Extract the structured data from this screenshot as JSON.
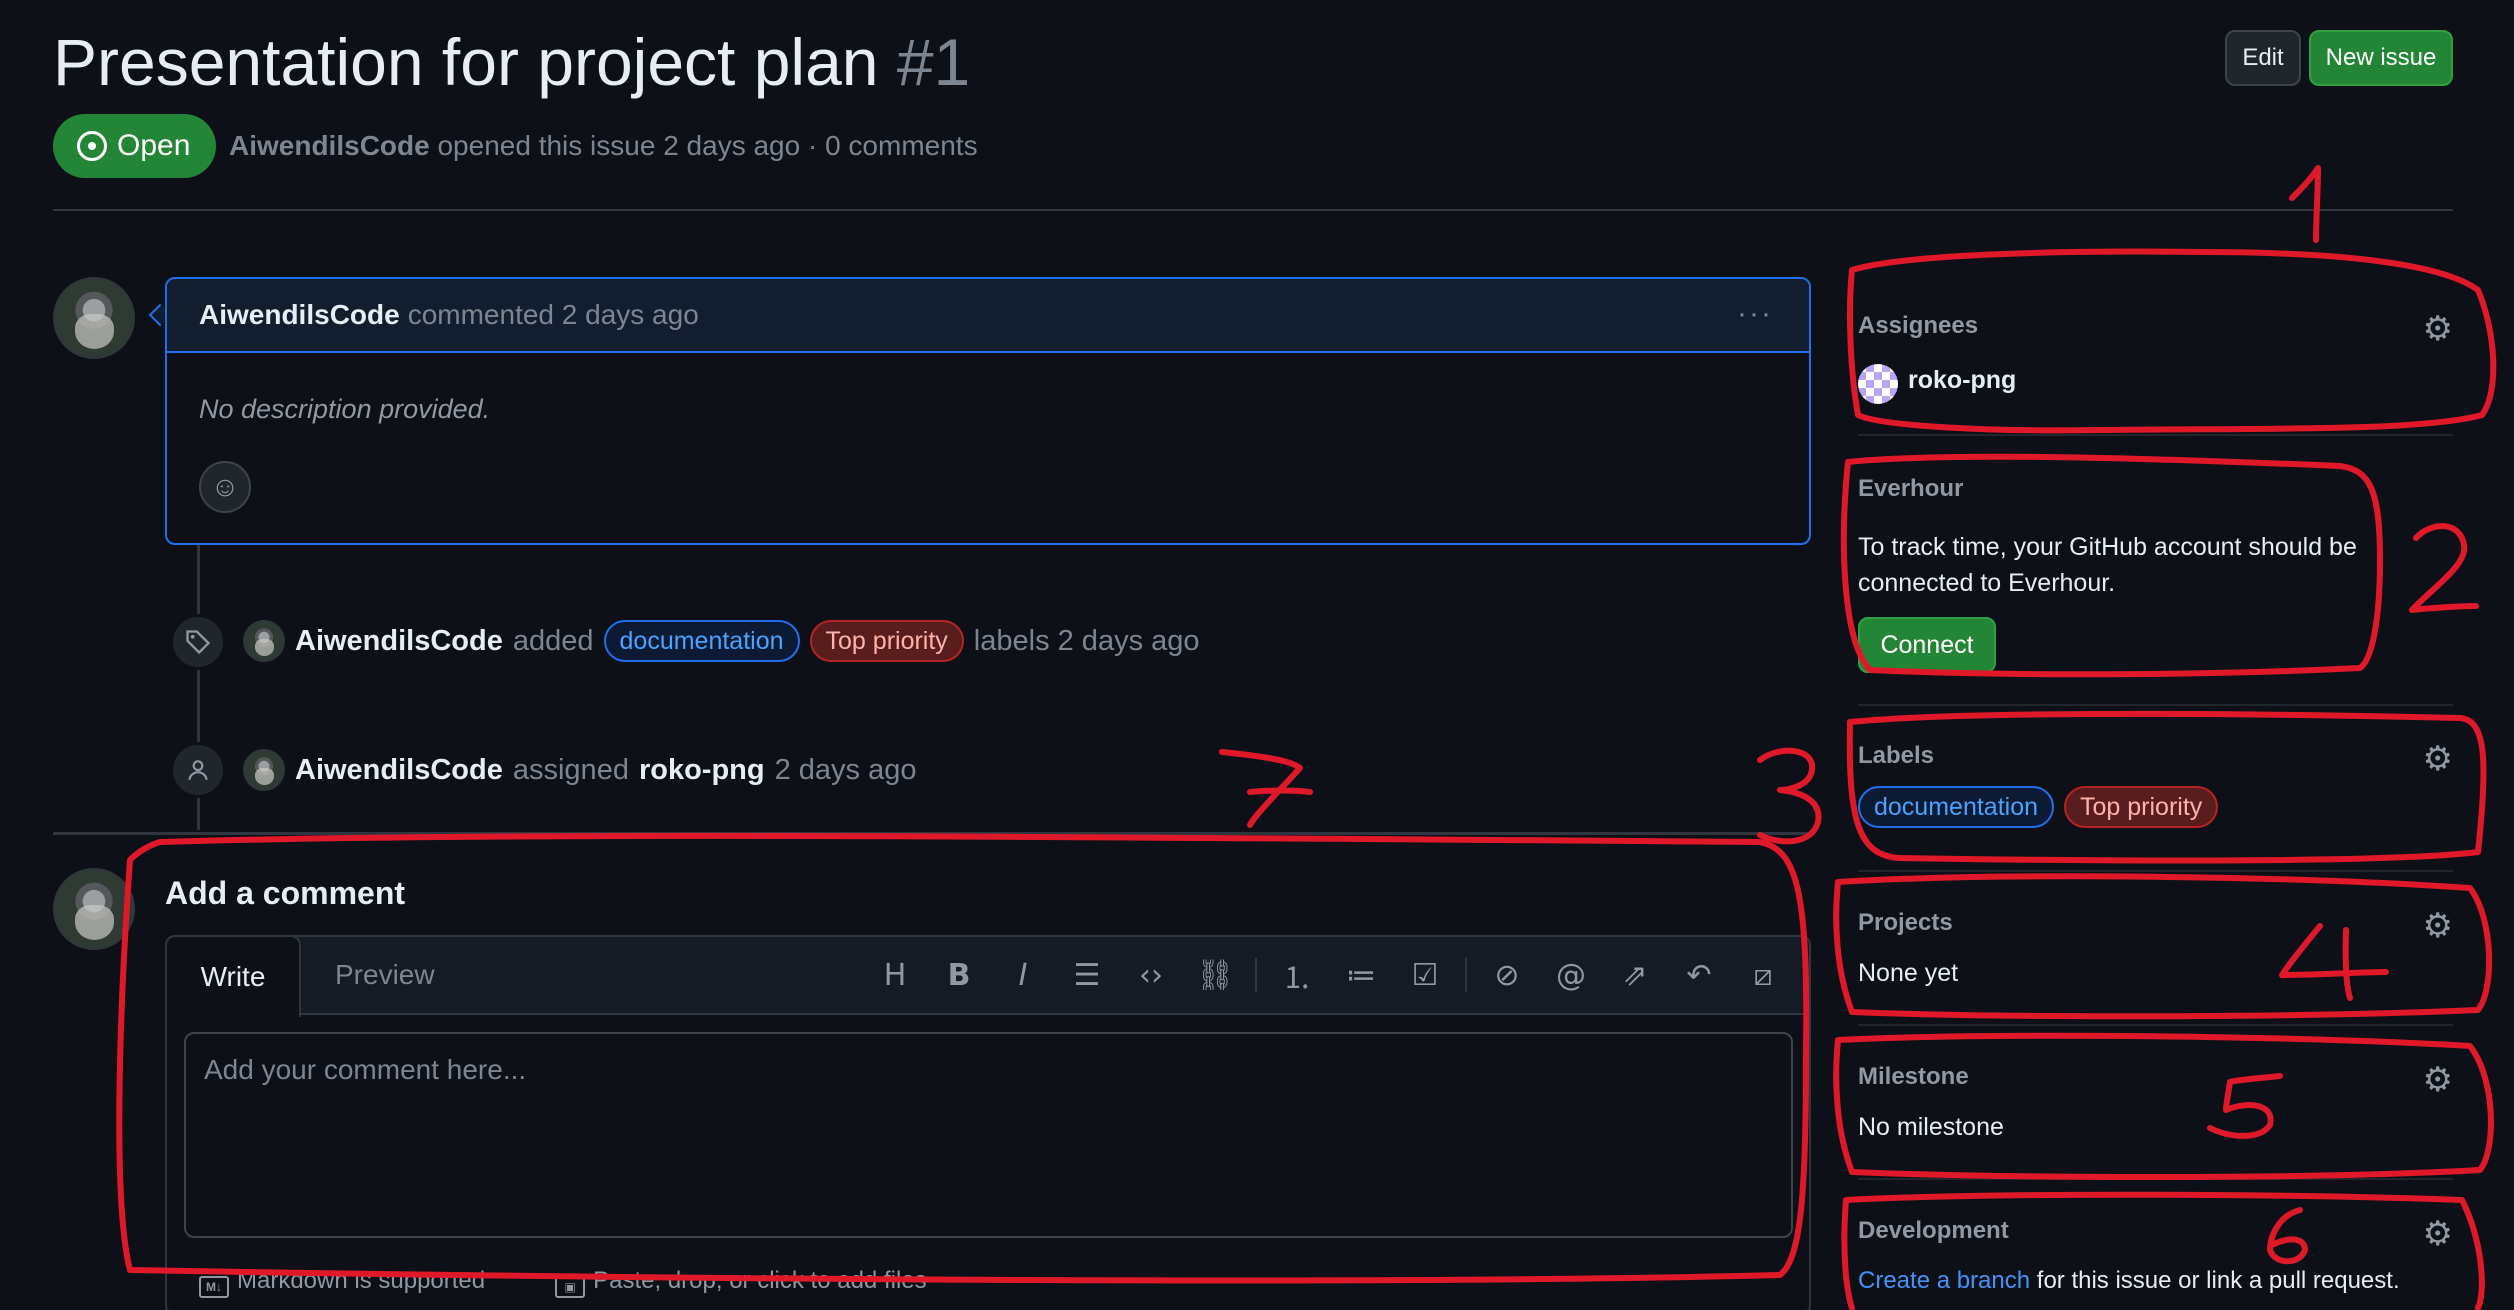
{
  "header": {
    "title": "Presentation for project plan",
    "number": "#1",
    "edit_label": "Edit",
    "new_issue_label": "New issue",
    "state": "Open",
    "author": "AiwendilsCode",
    "meta_rest": "opened this issue 2 days ago · 0 comments"
  },
  "comment": {
    "author": "AiwendilsCode",
    "action": "commented 2 days ago",
    "body": "No description provided.",
    "menu": "···"
  },
  "timeline": {
    "labels_event": {
      "author": "AiwendilsCode",
      "verb": "added",
      "label1": "documentation",
      "label2": "Top priority",
      "suffix": "labels 2 days ago"
    },
    "assign_event": {
      "author": "AiwendilsCode",
      "verb": "assigned",
      "target": "roko-png",
      "suffix": "2 days ago"
    }
  },
  "editor": {
    "title": "Add a comment",
    "tab_write": "Write",
    "tab_preview": "Preview",
    "placeholder": "Add your comment here...",
    "markdown_note": "Markdown is supported",
    "files_note": "Paste, drop, or click to add files",
    "tools": [
      "heading-icon",
      "bold-icon",
      "italic-icon",
      "quote-icon",
      "code-icon",
      "link-icon",
      "ordered-list-icon",
      "unordered-list-icon",
      "task-list-icon",
      "attach-icon",
      "mention-icon",
      "reference-icon",
      "undo-icon",
      "slash-command-icon"
    ]
  },
  "sidebar": {
    "assignees_title": "Assignees",
    "assignee": "roko-png",
    "everhour_title": "Everhour",
    "everhour_text": "To track time, your GitHub account should be connected to Everhour.",
    "connect_label": "Connect",
    "labels_title": "Labels",
    "label1": "documentation",
    "label2": "Top priority",
    "projects_title": "Projects",
    "projects_value": "None yet",
    "milestone_title": "Milestone",
    "milestone_value": "No milestone",
    "development_title": "Development",
    "dev_link": "Create a branch",
    "dev_rest": "for this issue or link a pull request."
  },
  "annotations": [
    "1",
    "2",
    "3",
    "4",
    "5",
    "6",
    "7"
  ],
  "colors": {
    "background": "#0d1117",
    "accent_green": "#238636",
    "link_blue": "#4493f8",
    "annotation_red": "#e0192a"
  }
}
